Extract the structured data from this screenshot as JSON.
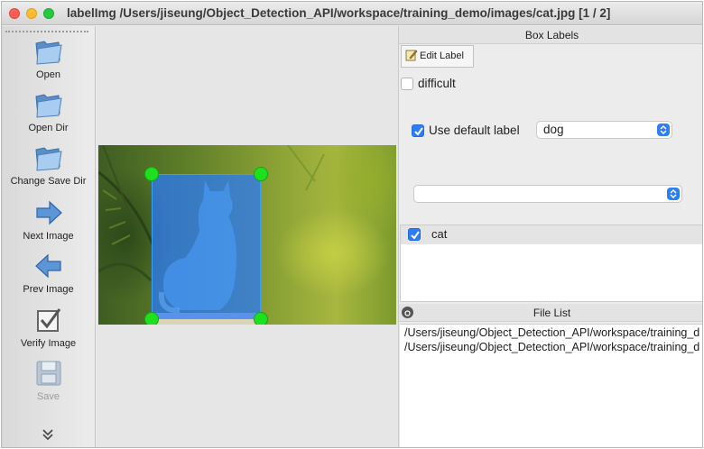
{
  "window": {
    "title": "labelImg /Users/jiseung/Object_Detection_API/workspace/training_demo/images/cat.jpg [1 / 2]"
  },
  "toolbar": {
    "items": [
      {
        "label": "Open",
        "icon": "folder-icon",
        "enabled": true
      },
      {
        "label": "Open Dir",
        "icon": "folder-icon",
        "enabled": true
      },
      {
        "label": "Change Save Dir",
        "icon": "folder-icon",
        "enabled": true
      },
      {
        "label": "Next Image",
        "icon": "arrow-right-icon",
        "enabled": true
      },
      {
        "label": "Prev Image",
        "icon": "arrow-left-icon",
        "enabled": true
      },
      {
        "label": "Verify Image",
        "icon": "checkbox-icon",
        "enabled": true
      },
      {
        "label": "Save",
        "icon": "floppy-disk-icon",
        "enabled": false
      }
    ],
    "more_icon": "double-chevron-down-icon"
  },
  "box_labels": {
    "title": "Box Labels",
    "edit_label": "Edit Label",
    "difficult_label": "difficult",
    "difficult_checked": false,
    "use_default_label": "Use default label",
    "use_default_checked": true,
    "default_label_value": "dog",
    "second_combo_value": "",
    "labels": [
      {
        "name": "cat",
        "checked": true
      }
    ]
  },
  "file_list": {
    "title": "File List",
    "files": [
      "/Users/jiseung/Object_Detection_API/workspace/training_d",
      "/Users/jiseung/Object_Detection_API/workspace/training_d"
    ]
  },
  "colors": {
    "bbox_fill": "#2878ff",
    "handle": "#1fe01f",
    "accent": "#2d7df6"
  }
}
